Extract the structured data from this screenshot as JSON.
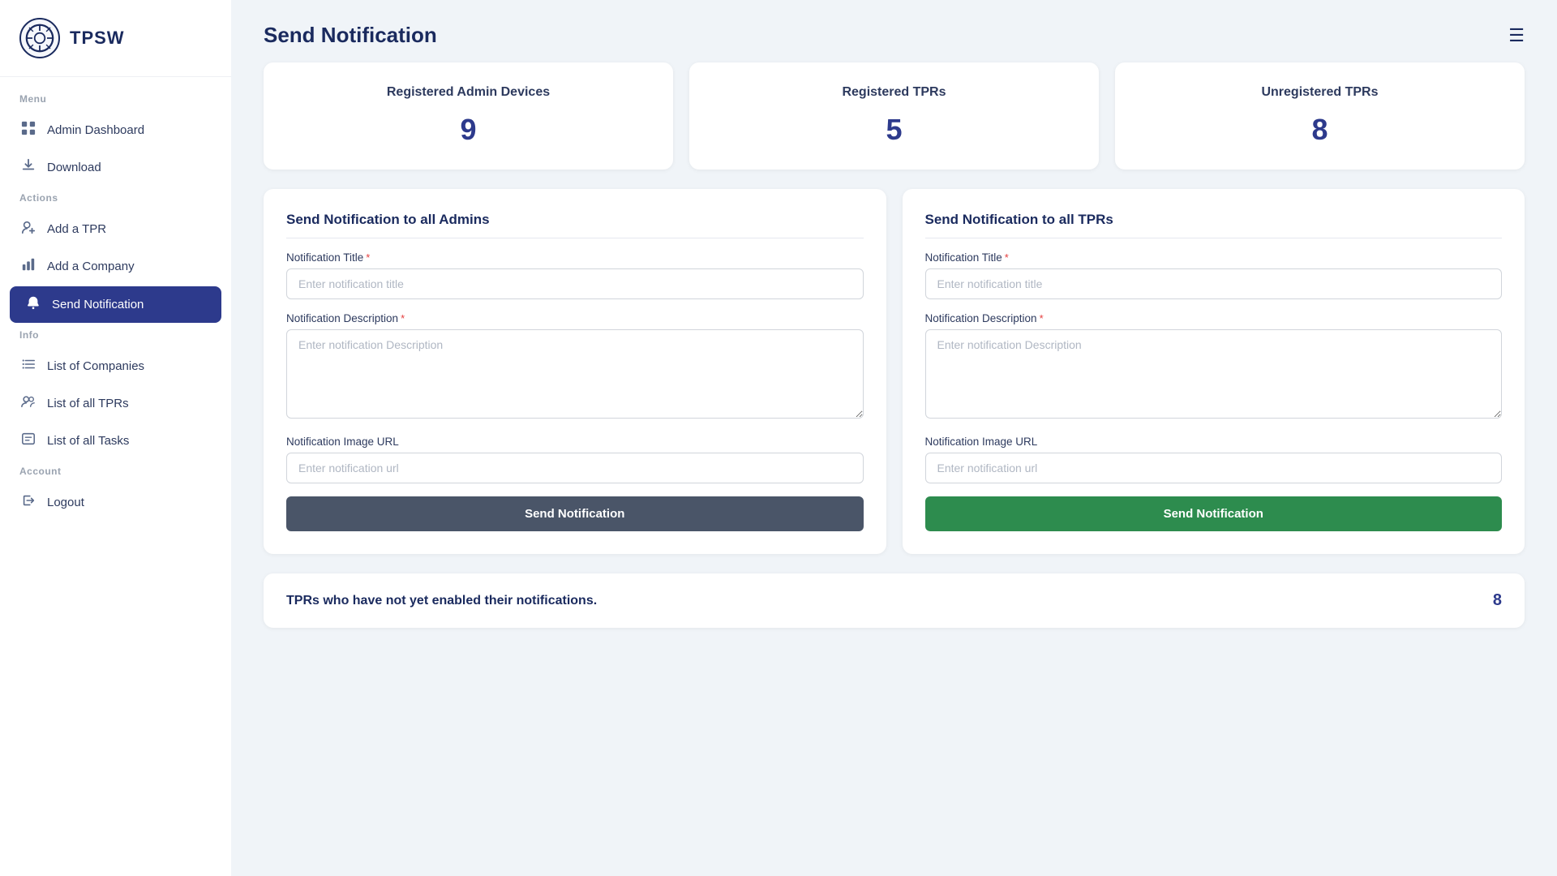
{
  "app": {
    "name": "TPSW",
    "logo_symbol": "⚙"
  },
  "sidebar": {
    "menu_label": "Menu",
    "info_label": "Info",
    "account_label": "Account",
    "items": [
      {
        "id": "admin-dashboard",
        "label": "Admin Dashboard",
        "icon": "grid",
        "active": false
      },
      {
        "id": "download",
        "label": "Download",
        "icon": "download",
        "active": false
      },
      {
        "id": "add-tpr",
        "label": "Add a TPR",
        "icon": "person-add",
        "active": false
      },
      {
        "id": "add-company",
        "label": "Add a Company",
        "icon": "bar-chart",
        "active": false
      },
      {
        "id": "send-notification",
        "label": "Send Notification",
        "icon": "bell",
        "active": true
      },
      {
        "id": "list-companies",
        "label": "List of Companies",
        "icon": "list",
        "active": false
      },
      {
        "id": "list-tprs",
        "label": "List of all TPRs",
        "icon": "people",
        "active": false
      },
      {
        "id": "list-tasks",
        "label": "List of all Tasks",
        "icon": "tasks",
        "active": false
      },
      {
        "id": "logout",
        "label": "Logout",
        "icon": "logout",
        "active": false
      }
    ]
  },
  "header": {
    "title": "Send Notification",
    "hamburger_label": "☰"
  },
  "stats": {
    "cards": [
      {
        "title": "Registered Admin Devices",
        "value": "9"
      },
      {
        "title": "Registered TPRs",
        "value": "5"
      },
      {
        "title": "Unregistered TPRs",
        "value": "8"
      }
    ]
  },
  "forms": {
    "admins": {
      "title": "Send Notification to all Admins",
      "title_label": "Notification Title",
      "title_placeholder": "Enter notification title",
      "desc_label": "Notification Description",
      "desc_placeholder": "Enter notification Description",
      "url_label": "Notification Image URL",
      "url_placeholder": "Enter notification url",
      "button_label": "Send Notification"
    },
    "tprs": {
      "title": "Send Notification to all TPRs",
      "title_label": "Notification Title",
      "title_placeholder": "Enter notification title",
      "desc_label": "Notification Description",
      "desc_placeholder": "Enter notification Description",
      "url_label": "Notification Image URL",
      "url_placeholder": "Enter notification url",
      "button_label": "Send Notification"
    }
  },
  "bottom": {
    "label": "TPRs who have not yet enabled their notifications.",
    "value": "8"
  }
}
